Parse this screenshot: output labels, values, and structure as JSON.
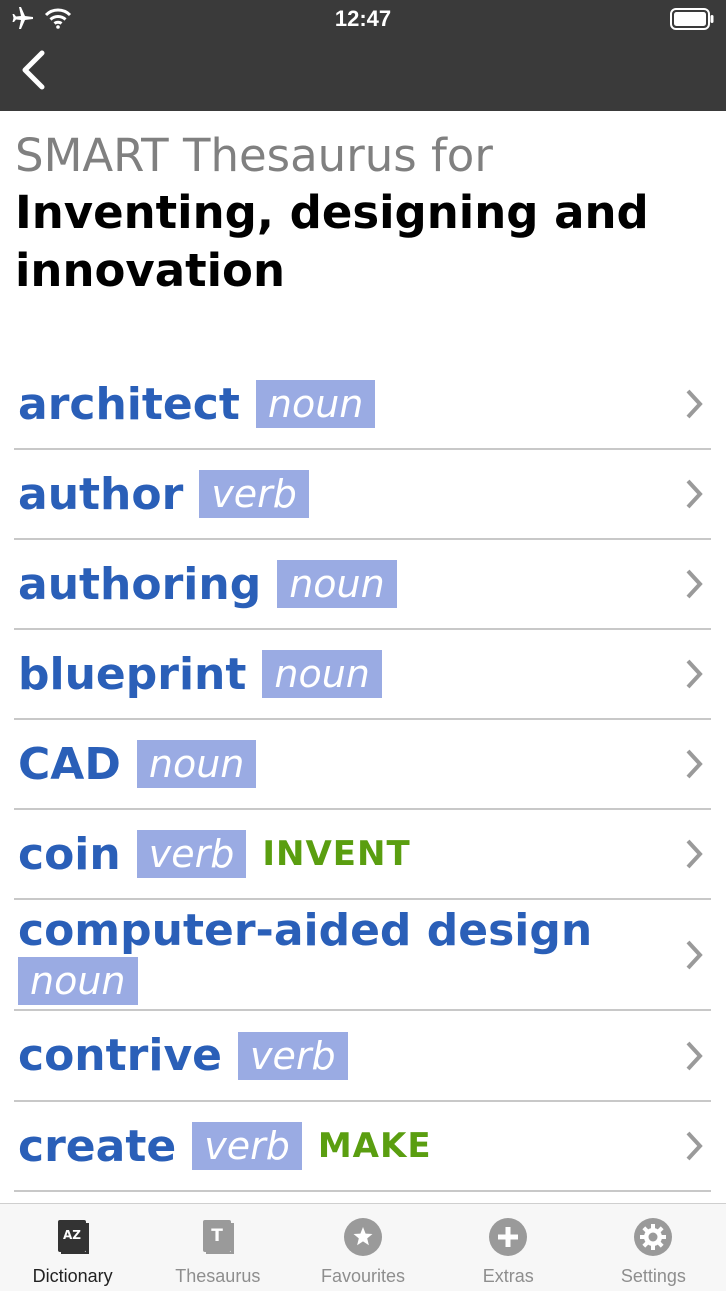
{
  "status_bar": {
    "time": "12:47"
  },
  "heading": {
    "subtitle": "SMART Thesaurus for",
    "title": "Inventing, designing and innovation"
  },
  "entries": [
    {
      "word": "architect",
      "pos": "noun",
      "guide": ""
    },
    {
      "word": "author",
      "pos": "verb",
      "guide": ""
    },
    {
      "word": "authoring",
      "pos": "noun",
      "guide": ""
    },
    {
      "word": "blueprint",
      "pos": "noun",
      "guide": ""
    },
    {
      "word": "CAD",
      "pos": "noun",
      "guide": ""
    },
    {
      "word": "coin",
      "pos": "verb",
      "guide": "INVENT"
    },
    {
      "word": "computer-aided design",
      "pos": "noun",
      "guide": ""
    },
    {
      "word": "contrive",
      "pos": "verb",
      "guide": ""
    },
    {
      "word": "create",
      "pos": "verb",
      "guide": "MAKE"
    }
  ],
  "tabs": [
    {
      "label": "Dictionary",
      "icon": "dictionary-icon",
      "active": true
    },
    {
      "label": "Thesaurus",
      "icon": "thesaurus-icon",
      "active": false
    },
    {
      "label": "Favourites",
      "icon": "star-icon",
      "active": false
    },
    {
      "label": "Extras",
      "icon": "plus-icon",
      "active": false
    },
    {
      "label": "Settings",
      "icon": "gear-icon",
      "active": false
    }
  ],
  "icon_glyphs": {
    "dictionary": "AZ",
    "thesaurus": "T"
  },
  "colors": {
    "header_bg": "#3a3a3a",
    "word": "#2a5fb8",
    "pos_bg": "#9aabe3",
    "guide": "#5a9e10"
  }
}
